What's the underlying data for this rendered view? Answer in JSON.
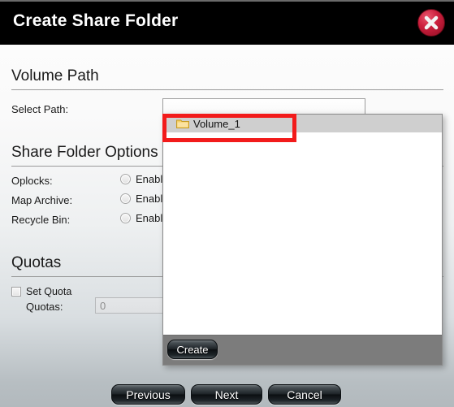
{
  "window": {
    "title": "Create Share Folder",
    "close_icon": "close-circle-icon"
  },
  "sections": {
    "volume_path": {
      "heading": "Volume Path",
      "select_path_label": "Select Path:",
      "select_path_value": "",
      "select_path_placeholder": ""
    },
    "share_folder_options": {
      "heading": "Share Folder Options",
      "rows": [
        {
          "label": "Oplocks:",
          "option": "Enable"
        },
        {
          "label": "Map Archive:",
          "option": "Enable"
        },
        {
          "label": "Recycle Bin:",
          "option": "Enable"
        }
      ]
    },
    "quotas": {
      "heading": "Quotas",
      "set_quota_label": "Set Quota",
      "set_quota_checked": false,
      "quotas_label": "Quotas:",
      "quotas_value": "0"
    }
  },
  "dropdown": {
    "items": [
      {
        "label": "Volume_1",
        "icon": "folder-icon"
      }
    ],
    "create_label": "Create"
  },
  "footer": {
    "previous_label": "Previous",
    "next_label": "Next",
    "cancel_label": "Cancel"
  },
  "annotation": {
    "color": "#f21b1b",
    "target": "Volume_1"
  },
  "colors": {
    "titlebar_bg": "#000000",
    "close_button": "#cc1f3d",
    "dialog_bg_top": "#fdfdfd",
    "dialog_bg_bottom": "#b2b9bd",
    "dropdown_item_selected": "#cfcfcf",
    "dropdown_footer": "#7c7c7c",
    "folder_icon": "#f2c14e"
  }
}
